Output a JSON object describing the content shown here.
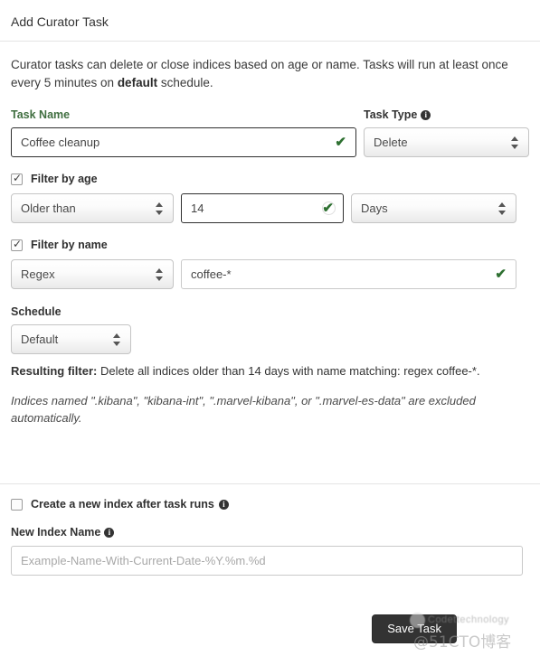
{
  "header": {
    "title": "Add Curator Task"
  },
  "intro": {
    "part1": "Curator tasks can delete or close indices based on age or name. Tasks will run at least once every 5 minutes on ",
    "bold": "default",
    "part2": " schedule."
  },
  "task_name": {
    "label": "Task Name",
    "value": "Coffee cleanup",
    "valid_icon": "✔"
  },
  "task_type": {
    "label": "Task Type",
    "info_icon": "info-icon",
    "value": "Delete"
  },
  "filter_age": {
    "checkbox_label": "Filter by age",
    "checked": true,
    "operator": "Older than",
    "amount": "14",
    "unit": "Days",
    "valid_icon": "✔"
  },
  "filter_name": {
    "checkbox_label": "Filter by name",
    "checked": true,
    "match_type": "Regex",
    "pattern": "coffee-*",
    "valid_icon": "✔"
  },
  "schedule": {
    "label": "Schedule",
    "value": "Default"
  },
  "resulting": {
    "label": "Resulting filter:",
    "text": " Delete all indices older than 14 days with name matching: regex coffee-*."
  },
  "note": {
    "text": "Indices named \".kibana\", \"kibana-int\", \".marvel-kibana\", or \".marvel-es-data\" are excluded automatically."
  },
  "create_index": {
    "checkbox_label": "Create a new index after task runs",
    "checked": false
  },
  "new_index": {
    "label": "New Index Name",
    "placeholder": "Example-Name-With-Current-Date-%Y.%m.%d",
    "value": ""
  },
  "footer": {
    "save_label": "Save Task"
  },
  "watermark": {
    "top_text": "Codettechnology",
    "main_text": "@51CTO博客"
  }
}
